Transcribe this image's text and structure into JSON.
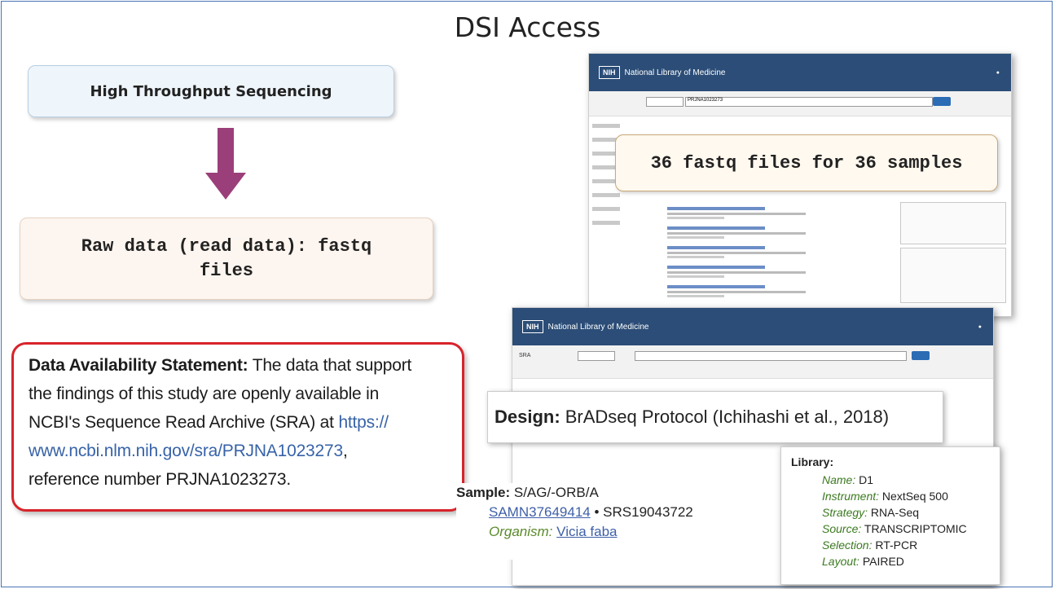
{
  "slide": {
    "title": "DSI Access"
  },
  "hts_box": {
    "label": "High Throughput Sequencing"
  },
  "raw_box": {
    "line1": "Raw data (read data): fastq",
    "line2": "files"
  },
  "das": {
    "heading": "Data Availability Statement:",
    "text1": "The data that support",
    "line2": "the findings of this study are openly available in",
    "line3a": "NCBI's Sequence Read Archive (SRA) at",
    "link_part1": "https://",
    "link_part2": "www.ncbi.nlm.nih.gov/sra/PRJNA1023273",
    "line4b": ",",
    "line5": "reference number PRJNA1023273."
  },
  "shot1": {
    "org_name": "National Library of Medicine",
    "search_value": "PRJNA1023273",
    "callout": "36 fastq files for 36 samples"
  },
  "shot2": {
    "org_name": "National Library of Medicine",
    "search_label": "SRA",
    "design_label": "Design:",
    "design_value": "BrADseq Protocol (Ichihashi et al., 2018)",
    "sample": {
      "label": "Sample:",
      "value": "S/AG/-ORB/A",
      "samn": "SAMN37649414",
      "srs": "SRS19043722",
      "organism_label": "Organism:",
      "organism_value": "Vicia faba"
    },
    "library": {
      "heading": "Library:",
      "rows": [
        {
          "key": "Name:",
          "value": "D1"
        },
        {
          "key": "Instrument:",
          "value": "NextSeq 500"
        },
        {
          "key": "Strategy:",
          "value": "RNA-Seq"
        },
        {
          "key": "Source:",
          "value": "TRANSCRIPTOMIC"
        },
        {
          "key": "Selection:",
          "value": "RT-PCR"
        },
        {
          "key": "Layout:",
          "value": "PAIRED"
        }
      ]
    }
  },
  "colors": {
    "arrow": "#9b3f7a",
    "das_border": "#d8232a",
    "nih_header": "#2b4d77",
    "link": "#3863a8"
  }
}
